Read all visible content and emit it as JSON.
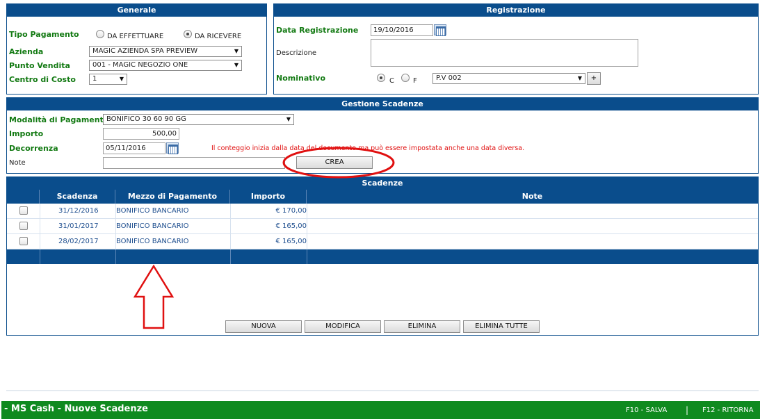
{
  "generale": {
    "title": "Generale",
    "tipo_pagamento_label": "Tipo Pagamento",
    "radio_effettuare": "DA EFFETTUARE",
    "radio_ricevere": "DA RICEVERE",
    "selected_tipo": "DA RICEVERE",
    "azienda_label": "Azienda",
    "azienda_value": "MAGIC AZIENDA SPA PREVIEW",
    "punto_vendita_label": "Punto Vendita",
    "punto_vendita_value": "001 - MAGIC NEGOZIO ONE",
    "centro_costo_label": "Centro di Costo",
    "centro_costo_value": "1"
  },
  "registrazione": {
    "title": "Registrazione",
    "data_label": "Data Registrazione",
    "data_value": "19/10/2016",
    "descrizione_label": "Descrizione",
    "descrizione_value": "",
    "nominativo_label": "Nominativo",
    "radio_c": "C",
    "radio_f": "F",
    "selected_nominativo": "C",
    "nominativo_value": "P.V 002",
    "add_button": "+"
  },
  "gestione": {
    "title": "Gestione Scadenze",
    "modalita_label": "Modalità di Pagamento",
    "modalita_value": "BONIFICO 30 60 90 GG",
    "importo_label": "Importo",
    "importo_value": "500,00",
    "decorrenza_label": "Decorrenza",
    "decorrenza_value": "05/11/2016",
    "info_text": "Il conteggio inizia dalla data del documento ma può essere impostata anche una data diversa.",
    "note_label": "Note",
    "note_value": "",
    "crea_button": "CREA"
  },
  "scadenze": {
    "title": "Scadenze",
    "columns": [
      "Scadenza",
      "Mezzo di Pagamento",
      "Importo",
      "Note"
    ],
    "rows": [
      {
        "scadenza": "31/12/2016",
        "mezzo": "BONIFICO BANCARIO",
        "importo": "€ 170,00",
        "note": ""
      },
      {
        "scadenza": "31/01/2017",
        "mezzo": "BONIFICO BANCARIO",
        "importo": "€ 165,00",
        "note": ""
      },
      {
        "scadenza": "28/02/2017",
        "mezzo": "BONIFICO BANCARIO",
        "importo": "€ 165,00",
        "note": ""
      }
    ],
    "buttons": {
      "nuova": "NUOVA",
      "modifica": "MODIFICA",
      "elimina": "ELIMINA",
      "elimina_tutte": "ELIMINA TUTTE"
    }
  },
  "status_bar": {
    "title": "MS Cash - Nuove Scadenze",
    "f10": "F10 - SALVA",
    "separator": "|",
    "f12": "F12 - RITORNA"
  },
  "colors": {
    "panel_header": "#0a4d8c",
    "label_green": "#137a13",
    "status_green": "#0f8a1f",
    "annotation_red": "#e01010"
  }
}
